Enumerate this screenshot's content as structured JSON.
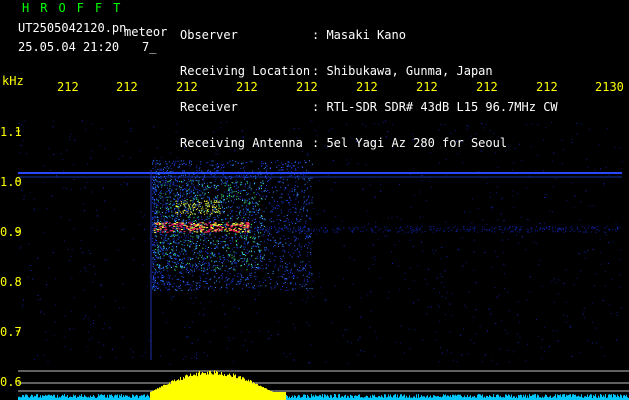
{
  "app_title": "HROFFT",
  "file": {
    "filename": "UT2505042120.pn",
    "tag": "meteor",
    "timestamp": "25.05.04 21:20",
    "count": "7_"
  },
  "info": {
    "labels": [
      "Observer",
      "Receiving Location",
      "Receiver",
      "Receiving Antenna"
    ],
    "values": [
      ": Masaki Kano",
      ": Shibukawa, Gunma, Japan",
      ": RTL-SDR SDR# 43dB L15 96.7MHz CW",
      ": 5el Yagi Az 280 for Seoul"
    ]
  },
  "axis": {
    "y_unit": "kHz",
    "x_ticks": [
      "212",
      "212",
      "212",
      "212",
      "212",
      "212",
      "212",
      "212",
      "212",
      "2130"
    ],
    "y_ticks": [
      "1.1",
      "1.0",
      "0.9",
      "0.8",
      "0.7",
      "0.6"
    ]
  },
  "colors": {
    "background": "#000000",
    "text_main": "#ffffff",
    "text_axis": "#ffff00",
    "title": "#00ff00",
    "noise": "#1428c8",
    "signal_hot": "#ff2060",
    "signal_warm": "#ffff40",
    "signal_cyan": "#40e0ff",
    "histogram": "#ffff00",
    "histogram_base": "#00c8ff"
  }
}
